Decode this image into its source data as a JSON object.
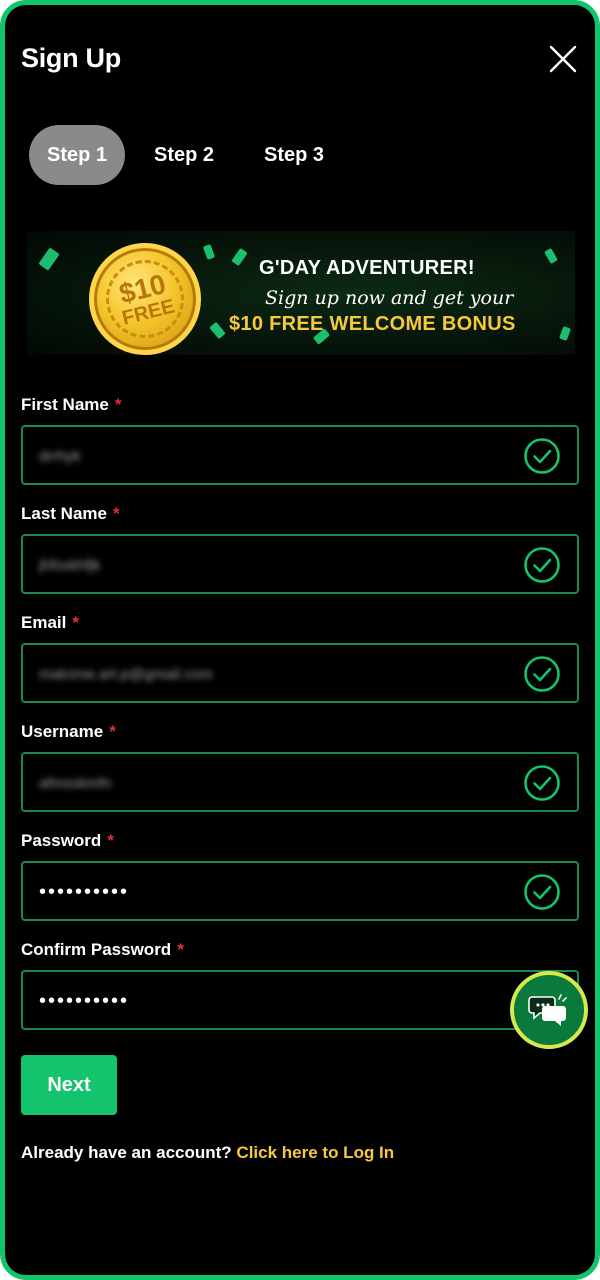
{
  "header": {
    "title": "Sign Up"
  },
  "steps": [
    {
      "label": "Step 1",
      "active": true
    },
    {
      "label": "Step 2",
      "active": false
    },
    {
      "label": "Step 3",
      "active": false
    }
  ],
  "banner": {
    "coin_amount": "$10",
    "coin_free": "FREE",
    "headline": "G'DAY ADVENTURER!",
    "subline": "Sign up now and get your",
    "bonus": "$10 FREE WELCOME BONUS"
  },
  "form": {
    "required_marker": "*",
    "fields": [
      {
        "label": "First Name",
        "value": "drrhyk",
        "valid": true
      },
      {
        "label": "Last Name",
        "value": "jhfsskhfjk",
        "valid": true
      },
      {
        "label": "Email",
        "value": "malcime.art.p@gmail.com",
        "valid": true
      },
      {
        "label": "Username",
        "value": "afmsskmfn",
        "valid": true
      },
      {
        "label": "Password",
        "value": "••••••••••",
        "valid": true
      },
      {
        "label": "Confirm Password",
        "value": "••••••••••",
        "valid": false
      }
    ],
    "next_label": "Next"
  },
  "footer": {
    "prompt": "Already have an account?",
    "link": "Click here to Log In"
  },
  "colors": {
    "accent": "#13c46c",
    "link": "#f6c93a",
    "required": "#e0303a",
    "step_active_bg": "#8a8a8a"
  },
  "icons": {
    "close": "close-icon",
    "valid": "check-circle-icon",
    "chat": "chat-bubbles-icon"
  }
}
